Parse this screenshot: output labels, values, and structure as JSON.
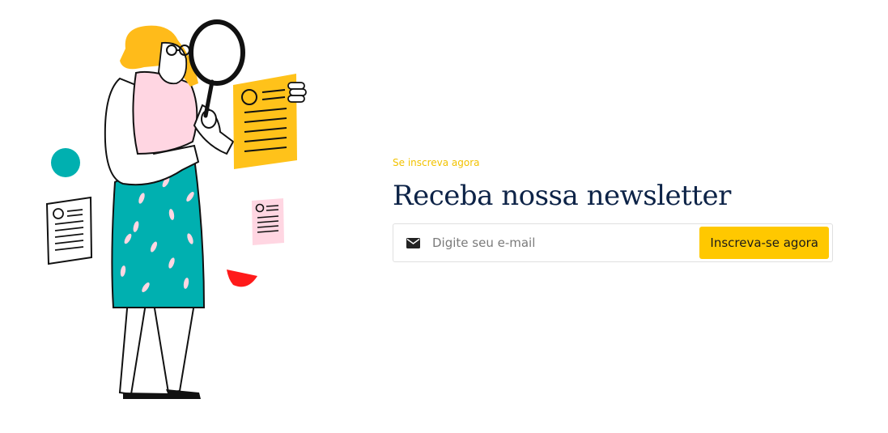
{
  "colors": {
    "accent": "#ffc800",
    "eyebrow": "#f2c200",
    "title": "#0d2347",
    "teal": "#00b0b0",
    "pink": "#ffd6e2",
    "red": "#ff1a1a"
  },
  "newsletter": {
    "eyebrow": "Se inscreva agora",
    "title": "Receba nossa newsletter",
    "email_icon": "envelope-icon",
    "email_placeholder": "Digite seu e-mail",
    "email_value": "",
    "submit_label": "Inscreva-se agora"
  },
  "illustration": {
    "description_icon": "woman-with-magnifying-glass-illustration"
  }
}
